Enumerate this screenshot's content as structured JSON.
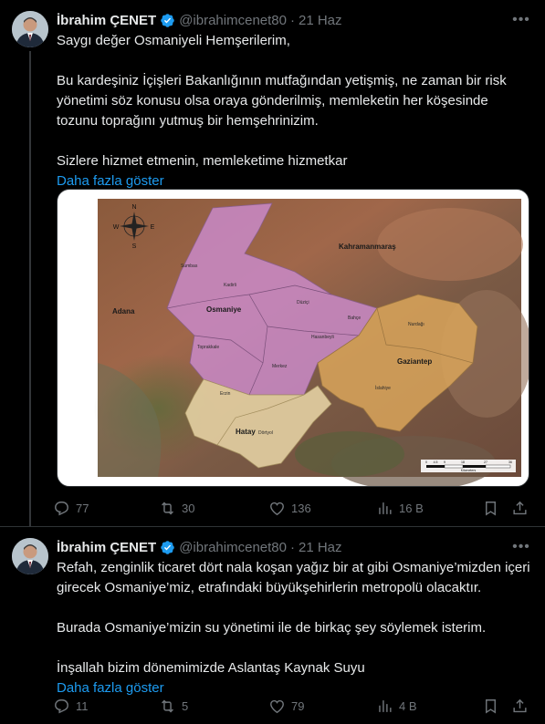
{
  "tweets": [
    {
      "author": {
        "name": "İbrahim ÇENET",
        "handle": "@ibrahimcenet80",
        "date": "21 Haz",
        "verified": true
      },
      "text": [
        "Saygı değer Osmaniyeli Hemşerilerim,",
        "",
        "Bu kardeşiniz İçişleri Bakanlığının mutfağından yetişmiş, ne zaman bir risk yönetimi söz konusu olsa oraya gönderilmiş, memleketin her köşesinde tozunu toprağını yutmuş bir hemşehrinizim.",
        "",
        "Sizlere hizmet etmenin, memleketime hizmetkar"
      ],
      "show_more": "Daha fazla göster",
      "map": {
        "labels": {
          "osmaniye": "Osmaniye",
          "adana": "Adana",
          "kahramanmaras": "Kahramanmaraş",
          "gaziantep": "Gaziantep",
          "hatay": "Hatay",
          "sumbas": "Sumbas",
          "kadirli": "Kadirli",
          "duzici": "Düziçi",
          "bahce": "Bahçe",
          "hasanbeyli": "Hasanbeyli",
          "toprakkale": "Toprakkale",
          "merkez": "Merkez",
          "nurdagi": "Nurdağı",
          "islahiye": "İslahiye",
          "erzin": "Erzin",
          "dortyol": "Dörtyol",
          "compass_n": "N",
          "compass_s": "S",
          "compass_e": "E",
          "compass_w": "W",
          "scale_ticks": [
            "0",
            "4.5",
            "9",
            "18",
            "27",
            "36"
          ],
          "scale_unit": "Kilometers"
        }
      },
      "stats": {
        "replies": "77",
        "reposts": "30",
        "likes": "136",
        "views": "16 B"
      }
    },
    {
      "author": {
        "name": "İbrahim ÇENET",
        "handle": "@ibrahimcenet80",
        "date": "21 Haz",
        "verified": true
      },
      "text": [
        "Refah, zenginlik ticaret dört nala koşan yağız bir at gibi Osmaniye’mizden içeri girecek Osmaniye’miz, etrafındaki büyükşehirlerin metropolü olacaktır.",
        "",
        "Burada Osmaniye’mizin su yönetimi ile de birkaç şey söylemek isterim.",
        "",
        "İnşallah bizim dönemimizde Aslantaş Kaynak Suyu"
      ],
      "show_more": "Daha fazla göster",
      "stats": {
        "replies": "11",
        "reposts": "5",
        "likes": "79",
        "views": "4 B"
      }
    }
  ],
  "colors": {
    "background": "#000000",
    "text": "#e7e9ea",
    "muted": "#71767b",
    "link": "#1d9bf0",
    "verified": "#1d9bf0",
    "divider": "#2f3336"
  },
  "icons": [
    "more-icon",
    "verified-badge-icon",
    "reply-icon",
    "repost-icon",
    "like-icon",
    "views-icon",
    "bookmark-icon",
    "share-icon",
    "compass-icon"
  ]
}
